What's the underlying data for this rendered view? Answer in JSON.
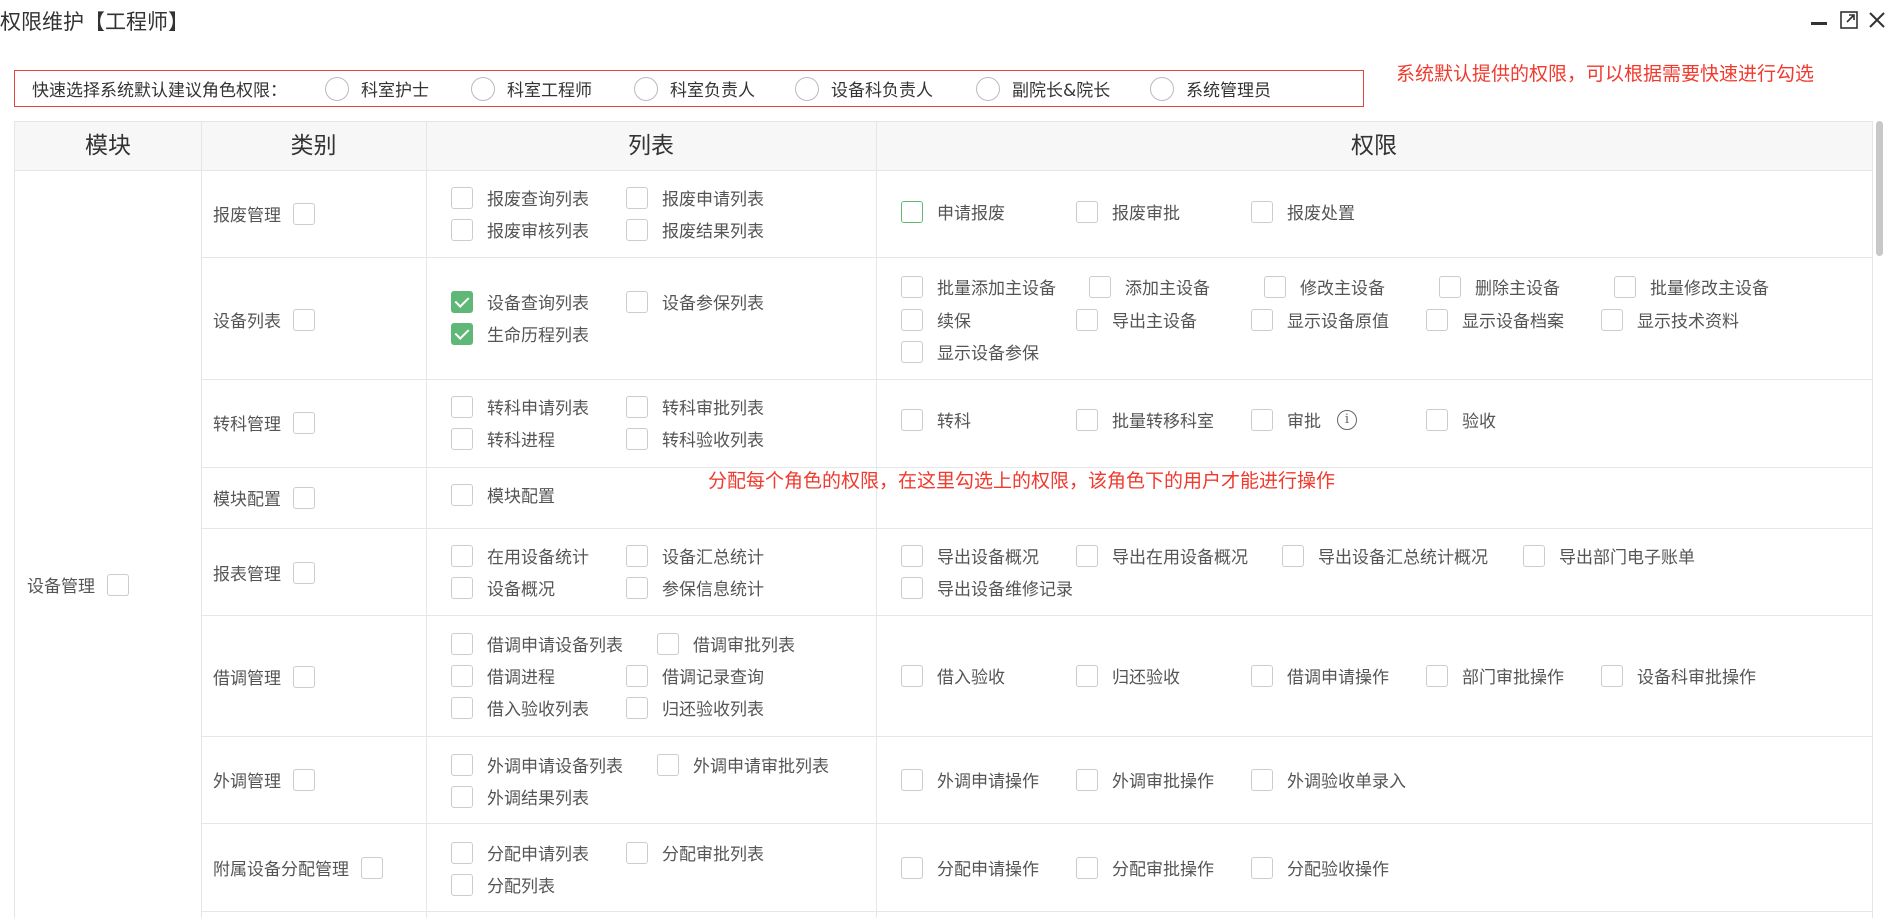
{
  "window": {
    "title": "权限维护【工程师】"
  },
  "quick_select": {
    "label": "快速选择系统默认建议角色权限：",
    "options": [
      "科室护士",
      "科室工程师",
      "科室负责人",
      "设备科负责人",
      "副院长&院长",
      "系统管理员"
    ]
  },
  "annotations": {
    "top": "系统默认提供的权限，可以根据需要快速进行勾选",
    "middle": "分配每个角色的权限，在这里勾选上的权限，该角色下的用户才能进行操作"
  },
  "table": {
    "headers": [
      "模块",
      "类别",
      "列表",
      "权限"
    ],
    "module": "设备管理",
    "rows": [
      {
        "category": "报废管理",
        "lists": [
          {
            "label": "报废查询列表",
            "checked": false
          },
          {
            "label": "报废申请列表",
            "checked": false
          },
          {
            "label": "报废审核列表",
            "checked": false
          },
          {
            "label": "报废结果列表",
            "checked": false
          }
        ],
        "perms": [
          {
            "label": "申请报废",
            "checked": false
          },
          {
            "label": "报废审批",
            "checked": false
          },
          {
            "label": "报废处置",
            "checked": false
          }
        ]
      },
      {
        "category": "设备列表",
        "lists": [
          {
            "label": "设备查询列表",
            "checked": true
          },
          {
            "label": "设备参保列表",
            "checked": false
          },
          {
            "label": "生命历程列表",
            "checked": true
          }
        ],
        "perms": [
          {
            "label": "批量添加主设备",
            "checked": false
          },
          {
            "label": "添加主设备",
            "checked": false
          },
          {
            "label": "修改主设备",
            "checked": false
          },
          {
            "label": "删除主设备",
            "checked": false
          },
          {
            "label": "批量修改主设备",
            "checked": false
          },
          {
            "label": "续保",
            "checked": false
          },
          {
            "label": "导出主设备",
            "checked": false
          },
          {
            "label": "显示设备原值",
            "checked": false
          },
          {
            "label": "显示设备档案",
            "checked": false
          },
          {
            "label": "显示技术资料",
            "checked": false
          },
          {
            "label": "显示设备参保",
            "checked": false
          }
        ]
      },
      {
        "category": "转科管理",
        "lists": [
          {
            "label": "转科申请列表",
            "checked": false
          },
          {
            "label": "转科审批列表",
            "checked": false
          },
          {
            "label": "转科进程",
            "checked": false
          },
          {
            "label": "转科验收列表",
            "checked": false
          }
        ],
        "perms": [
          {
            "label": "转科",
            "checked": false
          },
          {
            "label": "批量转移科室",
            "checked": false
          },
          {
            "label": "审批",
            "checked": false
          },
          {
            "label": "验收",
            "checked": false
          }
        ]
      },
      {
        "category": "模块配置",
        "lists": [
          {
            "label": "模块配置",
            "checked": false
          }
        ],
        "perms": []
      },
      {
        "category": "报表管理",
        "lists": [
          {
            "label": "在用设备统计",
            "checked": false
          },
          {
            "label": "设备汇总统计",
            "checked": false
          },
          {
            "label": "设备概况",
            "checked": false
          },
          {
            "label": "参保信息统计",
            "checked": false
          }
        ],
        "perms": [
          {
            "label": "导出设备概况",
            "checked": false
          },
          {
            "label": "导出在用设备概况",
            "checked": false
          },
          {
            "label": "导出设备汇总统计概况",
            "checked": false
          },
          {
            "label": "导出部门电子账单",
            "checked": false
          },
          {
            "label": "导出设备维修记录",
            "checked": false
          }
        ]
      },
      {
        "category": "借调管理",
        "lists": [
          {
            "label": "借调申请设备列表",
            "checked": false
          },
          {
            "label": "借调审批列表",
            "checked": false
          },
          {
            "label": "借调进程",
            "checked": false
          },
          {
            "label": "借调记录查询",
            "checked": false
          },
          {
            "label": "借入验收列表",
            "checked": false
          },
          {
            "label": "归还验收列表",
            "checked": false
          }
        ],
        "perms": [
          {
            "label": "借入验收",
            "checked": false
          },
          {
            "label": "归还验收",
            "checked": false
          },
          {
            "label": "借调申请操作",
            "checked": false
          },
          {
            "label": "部门审批操作",
            "checked": false
          },
          {
            "label": "设备科审批操作",
            "checked": false
          }
        ]
      },
      {
        "category": "外调管理",
        "lists": [
          {
            "label": "外调申请设备列表",
            "checked": false
          },
          {
            "label": "外调申请审批列表",
            "checked": false
          },
          {
            "label": "外调结果列表",
            "checked": false
          }
        ],
        "perms": [
          {
            "label": "外调申请操作",
            "checked": false
          },
          {
            "label": "外调审批操作",
            "checked": false
          },
          {
            "label": "外调验收单录入",
            "checked": false
          }
        ]
      },
      {
        "category": "附属设备分配管理",
        "lists": [
          {
            "label": "分配申请列表",
            "checked": false
          },
          {
            "label": "分配审批列表",
            "checked": false
          },
          {
            "label": "分配列表",
            "checked": false
          }
        ],
        "perms": [
          {
            "label": "分配申请操作",
            "checked": false
          },
          {
            "label": "分配审批操作",
            "checked": false
          },
          {
            "label": "分配验收操作",
            "checked": false
          }
        ]
      }
    ]
  },
  "icons": {
    "minimize": "minimize-icon",
    "maximize": "maximize-icon",
    "close": "close-icon",
    "info": "info-icon"
  },
  "colors": {
    "annotation": "#f03a2e",
    "checked": "#5fb878",
    "border": "#e6e6e6"
  }
}
